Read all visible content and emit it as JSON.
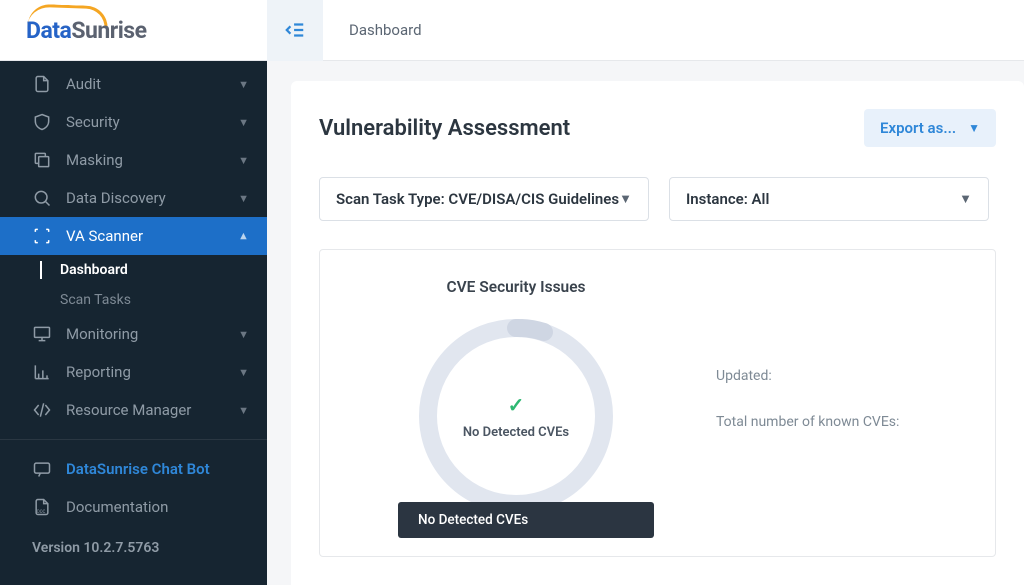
{
  "logo": {
    "part1": "Data",
    "part2": "Sunrise"
  },
  "breadcrumb": "Dashboard",
  "sidebar": {
    "items": [
      {
        "label": "Audit"
      },
      {
        "label": "Security"
      },
      {
        "label": "Masking"
      },
      {
        "label": "Data Discovery"
      },
      {
        "label": "VA Scanner"
      },
      {
        "label": "Monitoring"
      },
      {
        "label": "Reporting"
      },
      {
        "label": "Resource Manager"
      }
    ],
    "sub": [
      {
        "label": "Dashboard"
      },
      {
        "label": "Scan Tasks"
      }
    ],
    "chatbot": "DataSunrise Chat Bot",
    "documentation": "Documentation",
    "version": "Version 10.2.7.5763"
  },
  "page": {
    "title": "Vulnerability Assessment",
    "export": "Export as..."
  },
  "filters": {
    "scan": "Scan Task Type: CVE/DISA/CIS Guidelines",
    "instance": "Instance: All"
  },
  "cve_panel": {
    "title": "CVE Security Issues",
    "no_detected": "No Detected CVEs",
    "tooltip": "No Detected CVEs",
    "updated": "Updated:",
    "total": "Total number of known CVEs:"
  },
  "chart_data": {
    "type": "pie",
    "title": "CVE Security Issues",
    "categories": [
      "No Detected CVEs"
    ],
    "values": [
      100
    ],
    "annotations": [
      "No Detected CVEs"
    ]
  }
}
